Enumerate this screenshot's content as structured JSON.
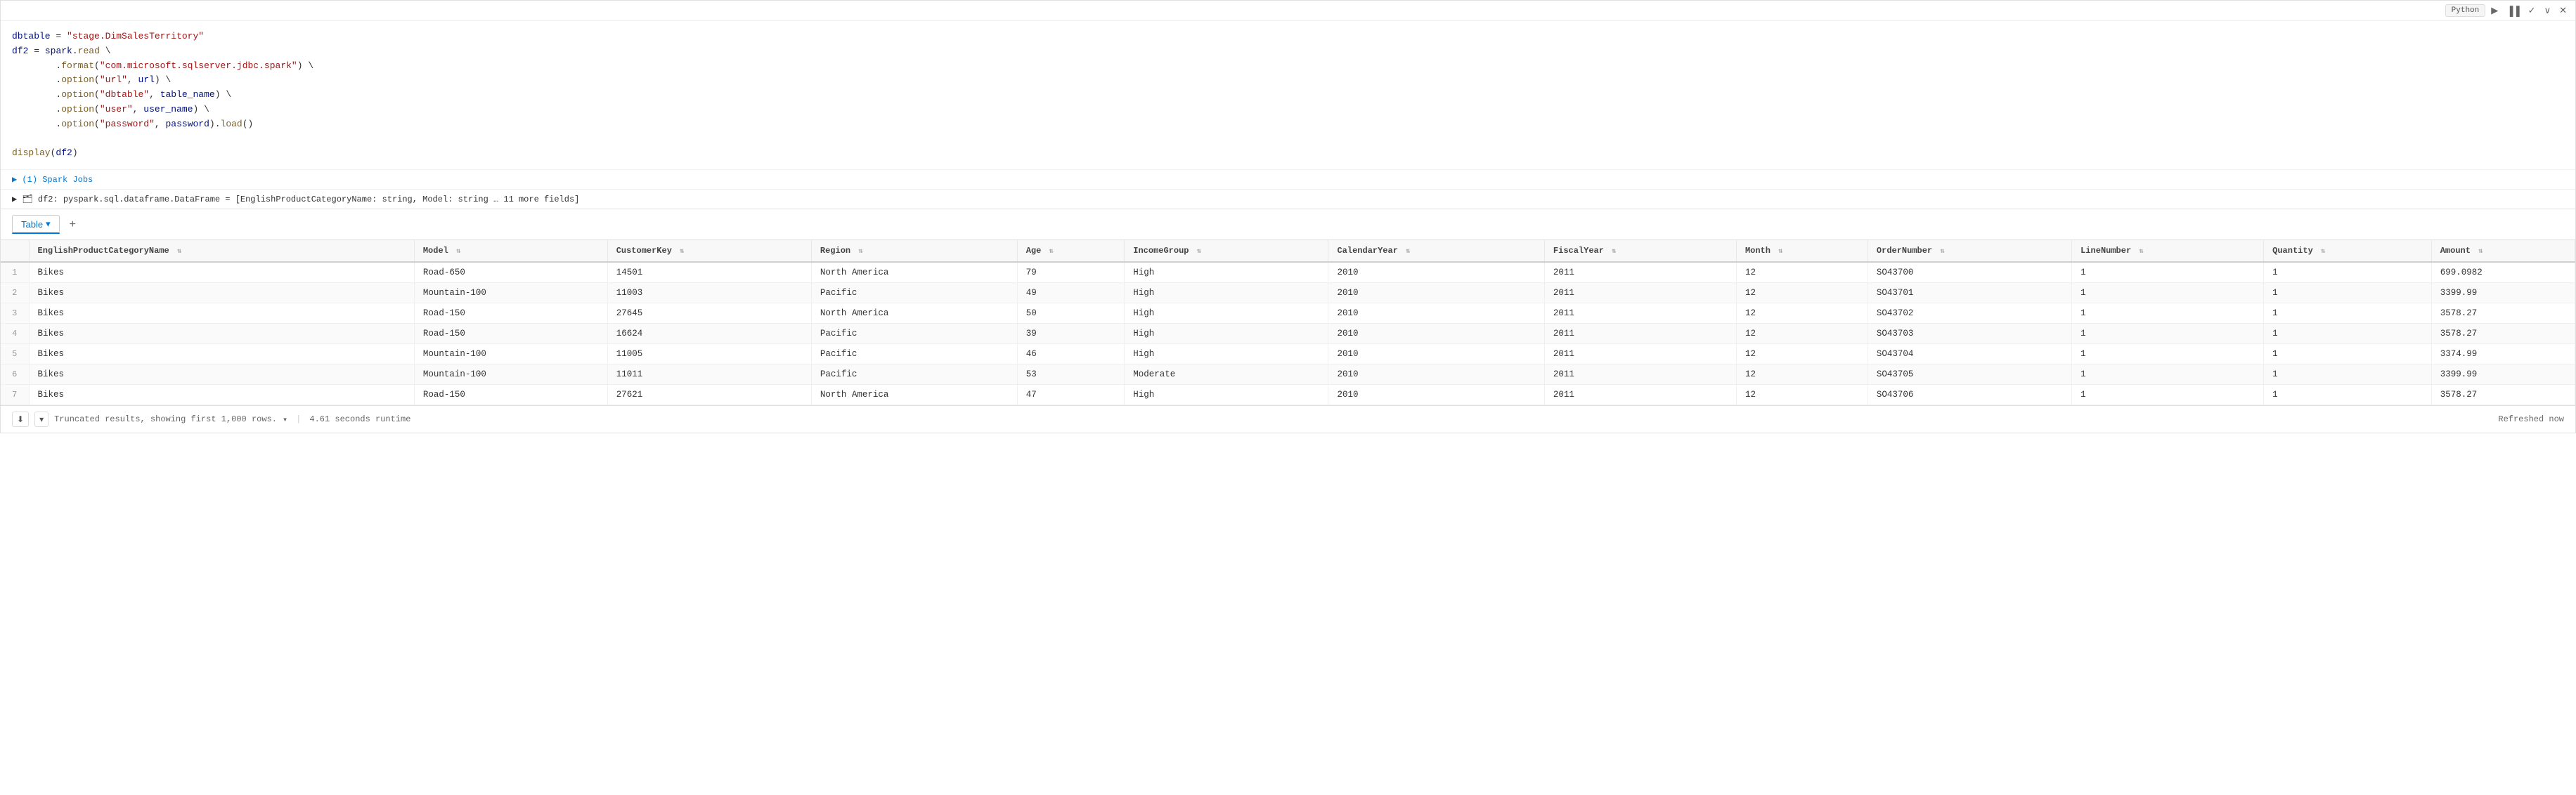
{
  "cell": {
    "lang": "Python",
    "code_lines": [
      {
        "type": "assignment",
        "text": "dbtable = \"stage.DimSalesTerritory\""
      },
      {
        "type": "assignment",
        "text": "df2 = spark.read \\"
      },
      {
        "type": "indent",
        "text": "       .format(\"com.microsoft.sqlserver.jdbc.spark\") \\"
      },
      {
        "type": "indent",
        "text": "       .option(\"url\", url) \\"
      },
      {
        "type": "indent",
        "text": "       .option(\"dbtable\", table_name) \\"
      },
      {
        "type": "indent",
        "text": "       .option(\"user\", user_name) \\"
      },
      {
        "type": "indent",
        "text": "       .option(\"password\", password).load()"
      },
      {
        "type": "blank",
        "text": ""
      },
      {
        "type": "call",
        "text": "display(df2)"
      }
    ],
    "toolbar": {
      "lang_label": "Python",
      "run_icon": "▶",
      "bar_icon": "▐▐",
      "check_icon": "✓",
      "chevron_icon": "∨",
      "close_icon": "✕"
    }
  },
  "spark_jobs": {
    "label": "▶ (1) Spark Jobs"
  },
  "df_info": {
    "label": "▶ 🗂 df2: pyspark.sql.dataframe.DataFrame = [EnglishProductCategoryName: string, Model: string … 11 more fields]"
  },
  "tabs": {
    "active_label": "Table",
    "active_chevron": "▾",
    "add_icon": "+"
  },
  "table": {
    "columns": [
      {
        "id": "rownum",
        "label": ""
      },
      {
        "id": "EnglishProductCategoryName",
        "label": "EnglishProductCategoryName"
      },
      {
        "id": "Model",
        "label": "Model"
      },
      {
        "id": "CustomerKey",
        "label": "CustomerKey"
      },
      {
        "id": "Region",
        "label": "Region"
      },
      {
        "id": "Age",
        "label": "Age"
      },
      {
        "id": "IncomeGroup",
        "label": "IncomeGroup"
      },
      {
        "id": "CalendarYear",
        "label": "CalendarYear"
      },
      {
        "id": "FiscalYear",
        "label": "FiscalYear"
      },
      {
        "id": "Month",
        "label": "Month"
      },
      {
        "id": "OrderNumber",
        "label": "OrderNumber"
      },
      {
        "id": "LineNumber",
        "label": "LineNumber"
      },
      {
        "id": "Quantity",
        "label": "Quantity"
      },
      {
        "id": "Amount",
        "label": "Amount"
      }
    ],
    "rows": [
      {
        "rownum": "1",
        "EnglishProductCategoryName": "Bikes",
        "Model": "Road-650",
        "CustomerKey": "14501",
        "Region": "North America",
        "Age": "79",
        "IncomeGroup": "High",
        "CalendarYear": "2010",
        "FiscalYear": "2011",
        "Month": "12",
        "OrderNumber": "SO43700",
        "LineNumber": "1",
        "Quantity": "1",
        "Amount": "699.0982"
      },
      {
        "rownum": "2",
        "EnglishProductCategoryName": "Bikes",
        "Model": "Mountain-100",
        "CustomerKey": "11003",
        "Region": "Pacific",
        "Age": "49",
        "IncomeGroup": "High",
        "CalendarYear": "2010",
        "FiscalYear": "2011",
        "Month": "12",
        "OrderNumber": "SO43701",
        "LineNumber": "1",
        "Quantity": "1",
        "Amount": "3399.99"
      },
      {
        "rownum": "3",
        "EnglishProductCategoryName": "Bikes",
        "Model": "Road-150",
        "CustomerKey": "27645",
        "Region": "North America",
        "Age": "50",
        "IncomeGroup": "High",
        "CalendarYear": "2010",
        "FiscalYear": "2011",
        "Month": "12",
        "OrderNumber": "SO43702",
        "LineNumber": "1",
        "Quantity": "1",
        "Amount": "3578.27"
      },
      {
        "rownum": "4",
        "EnglishProductCategoryName": "Bikes",
        "Model": "Road-150",
        "CustomerKey": "16624",
        "Region": "Pacific",
        "Age": "39",
        "IncomeGroup": "High",
        "CalendarYear": "2010",
        "FiscalYear": "2011",
        "Month": "12",
        "OrderNumber": "SO43703",
        "LineNumber": "1",
        "Quantity": "1",
        "Amount": "3578.27"
      },
      {
        "rownum": "5",
        "EnglishProductCategoryName": "Bikes",
        "Model": "Mountain-100",
        "CustomerKey": "11005",
        "Region": "Pacific",
        "Age": "46",
        "IncomeGroup": "High",
        "CalendarYear": "2010",
        "FiscalYear": "2011",
        "Month": "12",
        "OrderNumber": "SO43704",
        "LineNumber": "1",
        "Quantity": "1",
        "Amount": "3374.99"
      },
      {
        "rownum": "6",
        "EnglishProductCategoryName": "Bikes",
        "Model": "Mountain-100",
        "CustomerKey": "11011",
        "Region": "Pacific",
        "Age": "53",
        "IncomeGroup": "Moderate",
        "CalendarYear": "2010",
        "FiscalYear": "2011",
        "Month": "12",
        "OrderNumber": "SO43705",
        "LineNumber": "1",
        "Quantity": "1",
        "Amount": "3399.99"
      },
      {
        "rownum": "7",
        "EnglishProductCategoryName": "Bikes",
        "Model": "Road-150",
        "CustomerKey": "27621",
        "Region": "North America",
        "Age": "47",
        "IncomeGroup": "High",
        "CalendarYear": "2010",
        "FiscalYear": "2011",
        "Month": "12",
        "OrderNumber": "SO43706",
        "LineNumber": "1",
        "Quantity": "1",
        "Amount": "3578.27"
      }
    ]
  },
  "footer": {
    "truncated_text": "Truncated results, showing first 1,000 rows.",
    "chevron": "▾",
    "separator": "|",
    "runtime_text": "4.61 seconds runtime",
    "refreshed_text": "Refreshed now",
    "download_icon": "⬇",
    "expand_icon": "▾"
  }
}
